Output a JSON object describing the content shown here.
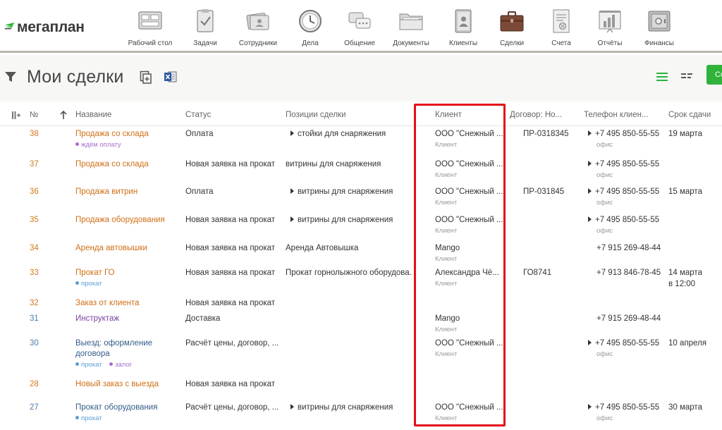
{
  "app": {
    "logo_text": "мегаплан"
  },
  "nav": [
    {
      "label": "Рабочий стол",
      "icon": "desktop-icon"
    },
    {
      "label": "Задачи",
      "icon": "tasks-icon"
    },
    {
      "label": "Сотрудники",
      "icon": "employees-icon"
    },
    {
      "label": "Дела",
      "icon": "clock-icon"
    },
    {
      "label": "Общение",
      "icon": "chat-icon"
    },
    {
      "label": "Документы",
      "icon": "folder-icon"
    },
    {
      "label": "Клиенты",
      "icon": "clients-icon"
    },
    {
      "label": "Сделки",
      "icon": "briefcase-icon"
    },
    {
      "label": "Счета",
      "icon": "invoice-icon"
    },
    {
      "label": "Отчёты",
      "icon": "report-icon"
    },
    {
      "label": "Финансы",
      "icon": "safe-icon"
    }
  ],
  "page": {
    "title": "Мои сделки",
    "create_label": "Создать"
  },
  "table": {
    "headers": {
      "num": "№",
      "name": "Название",
      "status": "Статус",
      "positions": "Позиции сделки",
      "client": "Клиент",
      "contract": "Договор: Но...",
      "phone": "Телефон клиен...",
      "deadline": "Срок сдачи"
    },
    "rows": [
      {
        "num": "38",
        "name": "Продажа со склада",
        "tags": [
          {
            "label": "ждём оплату",
            "color": "purple"
          }
        ],
        "status": "Оплата",
        "position": "стойки для снаряжения",
        "position_expand": true,
        "client": "ООО \"Снежный ...",
        "client_type": "Клиент",
        "contract": "ПР-0318345",
        "phone": "+7 495 850-55-55",
        "phone_type": "офис",
        "phone_expand": true,
        "deadline": "19 марта",
        "deadline2": ""
      },
      {
        "num": "37",
        "name": "Продажа со склада",
        "tags": [],
        "status": "Новая заявка на прокат",
        "position": "витрины для снаряжения",
        "position_expand": false,
        "client": "ООО \"Снежный ...",
        "client_type": "Клиент",
        "contract": "",
        "phone": "+7 495 850-55-55",
        "phone_type": "офис",
        "phone_expand": true,
        "deadline": "",
        "deadline2": ""
      },
      {
        "num": "36",
        "name": "Продажа витрин",
        "tags": [],
        "status": "Оплата",
        "position": "витрины для снаряжения",
        "position_expand": true,
        "client": "ООО \"Снежный ...",
        "client_type": "Клиент",
        "contract": "ПР-031845",
        "phone": "+7 495 850-55-55",
        "phone_type": "офис",
        "phone_expand": true,
        "deadline": "15 марта",
        "deadline2": ""
      },
      {
        "num": "35",
        "name": "Продажа оборудования",
        "tags": [],
        "status": "Новая заявка на прокат",
        "position": "витрины для снаряжения",
        "position_expand": true,
        "client": "ООО \"Снежный ...",
        "client_type": "Клиент",
        "contract": "",
        "phone": "+7 495 850-55-55",
        "phone_type": "офис",
        "phone_expand": true,
        "deadline": "",
        "deadline2": ""
      },
      {
        "num": "34",
        "name": "Аренда автовышки",
        "tags": [],
        "status": "Новая заявка на прокат",
        "position": "Аренда Автовышка",
        "position_expand": false,
        "client": "Mango",
        "client_type": "Клиент",
        "contract": "",
        "phone": "+7 915 269-48-44",
        "phone_type": "",
        "phone_expand": false,
        "deadline": "",
        "deadline2": ""
      },
      {
        "num": "33",
        "name": "Прокат ГО",
        "tags": [
          {
            "label": "прокат",
            "color": "blue"
          }
        ],
        "status": "Новая заявка на прокат",
        "position": "Прокат горнолыжного оборудова...",
        "position_expand": false,
        "client": "Александра Чё...",
        "client_type": "Клиент",
        "contract": "ГО8741",
        "phone": "+7 913 846-78-45",
        "phone_type": "",
        "phone_expand": false,
        "deadline": "14 марта",
        "deadline2": "в 12:00"
      },
      {
        "num": "32",
        "name": "Заказ от клиента",
        "tags": [],
        "status": "Новая заявка на прокат",
        "position": "",
        "position_expand": false,
        "client": "",
        "client_type": "",
        "contract": "",
        "phone": "",
        "phone_type": "",
        "phone_expand": false,
        "deadline": "",
        "deadline2": ""
      },
      {
        "num": "31",
        "name": "Инструктаж",
        "tags": [],
        "status": "Доставка",
        "position": "",
        "position_expand": false,
        "client": "Mango",
        "client_type": "Клиент",
        "contract": "",
        "phone": "+7 915 269-48-44",
        "phone_type": "",
        "phone_expand": false,
        "deadline": "",
        "deadline2": ""
      },
      {
        "num": "30",
        "name": "Выезд: оформление",
        "name2": "договора",
        "tags": [
          {
            "label": "прокат",
            "color": "blue"
          },
          {
            "label": "залог",
            "color": "purple"
          }
        ],
        "status": "Расчёт цены, договор, ...",
        "position": "",
        "position_expand": false,
        "client": "ООО \"Снежный ...",
        "client_type": "Клиент",
        "contract": "",
        "phone": "+7 495 850-55-55",
        "phone_type": "офис",
        "phone_expand": true,
        "deadline": "10 апреля",
        "deadline2": ""
      },
      {
        "num": "28",
        "name": "Новый заказ с выезда",
        "tags": [],
        "status": "Новая заявка на прокат",
        "position": "",
        "position_expand": false,
        "client": "",
        "client_type": "",
        "contract": "",
        "phone": "",
        "phone_type": "",
        "phone_expand": false,
        "deadline": "",
        "deadline2": ""
      },
      {
        "num": "27",
        "name": "Прокат оборудования",
        "tags": [
          {
            "label": "прокат",
            "color": "blue"
          }
        ],
        "status": "Расчёт цены, договор, ...",
        "position": "витрины для снаряжения",
        "position_expand": true,
        "client": "ООО \"Снежный ...",
        "client_type": "Клиент",
        "contract": "",
        "phone": "+7 495 850-55-55",
        "phone_type": "офис",
        "phone_expand": true,
        "deadline": "30 марта",
        "deadline2": ""
      }
    ]
  },
  "colors": {
    "accent_green": "#2fb33a",
    "highlight_red": "#e3101a",
    "deal_orange": "#cf6f16"
  }
}
